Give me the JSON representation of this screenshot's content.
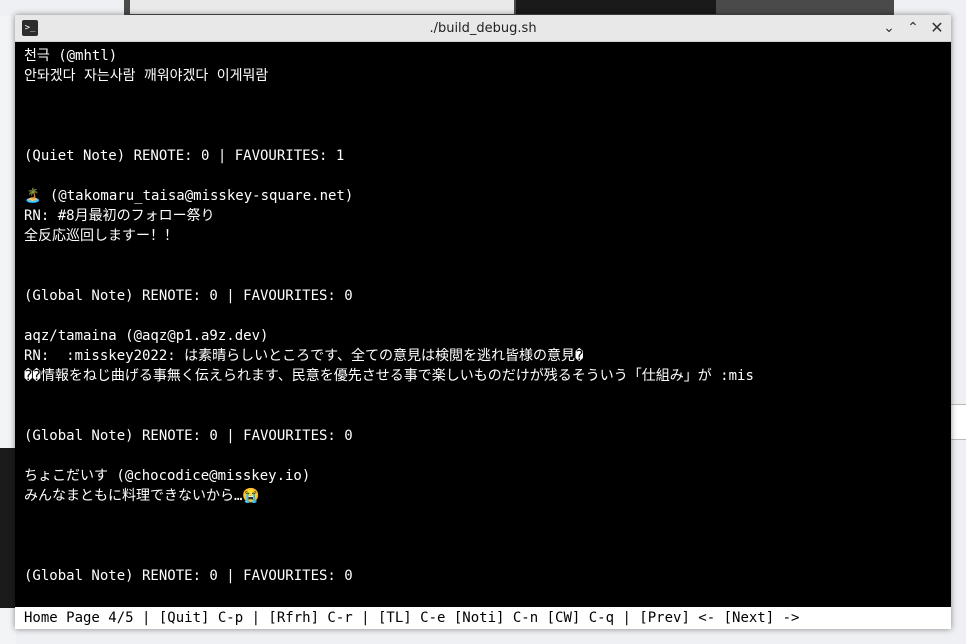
{
  "window": {
    "title": "./build_debug.sh",
    "icon": "terminal-icon",
    "controls": {
      "minimize": "⌄",
      "maximize": "⌃",
      "close": "✕"
    }
  },
  "terminal": {
    "lines": [
      "천극 (@mhtl)",
      "안돠겠다 자는사람 깨워야겠다 이게뭐람",
      "",
      "",
      "",
      "(Quiet Note) RENOTE: 0 | FAVOURITES: 1",
      "",
      "🏝️ (@takomaru_taisa@misskey-square.net)",
      "RN: #8月最初のフォロー祭り",
      "全反応巡回しますー！！",
      "",
      "",
      "(Global Note) RENOTE: 0 | FAVOURITES: 0",
      "",
      "aqz/tamaina (@aqz@p1.a9z.dev)",
      "RN:  :misskey2022: は素晴らしいところです、全ての意見は検閲を逃れ皆様の意見�",
      "��情報をねじ曲げる事無く伝えられます、民意を優先させる事で楽しいものだけが残るそういう「仕組み」が :mis",
      "",
      "",
      "(Global Note) RENOTE: 0 | FAVOURITES: 0",
      "",
      "ちょこだいす (@chocodice@misskey.io)",
      "みんなまともに料理できないから…😭",
      "",
      "",
      "",
      "(Global Note) RENOTE: 0 | FAVOURITES: 0"
    ]
  },
  "status_bar": {
    "text": "Home Page 4/5 | [Quit] C-p | [Rfrh] C-r | [TL] C-e [Noti] C-n [CW] C-q | [Prev] <- [Next] ->"
  }
}
